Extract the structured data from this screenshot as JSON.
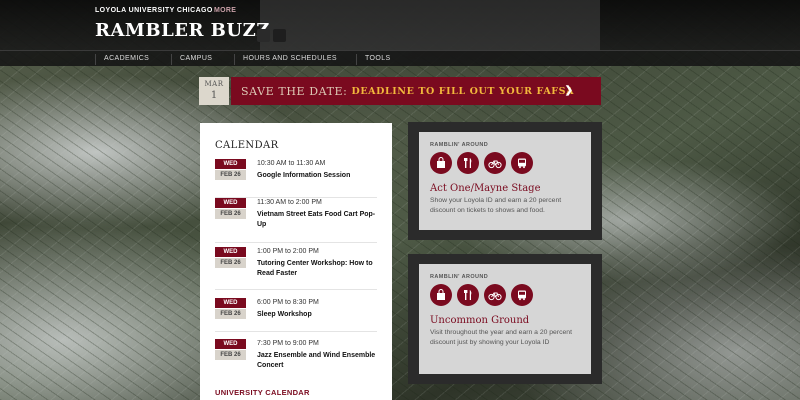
{
  "header": {
    "university": "LOYOLA UNIVERSITY CHICAGO",
    "more_label": "MORE",
    "site_title": "RAMBLER BUZZ"
  },
  "nav": {
    "items": [
      {
        "label": "ACADEMICS"
      },
      {
        "label": "CAMPUS"
      },
      {
        "label": "HOURS AND SCHEDULES"
      },
      {
        "label": "TOOLS"
      }
    ]
  },
  "banner": {
    "month": "MAR",
    "day": "1",
    "lead": "SAVE THE DATE:",
    "deadline": "DEADLINE TO FILL OUT YOUR FAFSA",
    "arrow_icon": "chevron-right-icon"
  },
  "calendar": {
    "title": "CALENDAR",
    "events": [
      {
        "weekday": "WED",
        "date": "FEB 26",
        "time": "10:30 AM to 11:30 AM",
        "name": "Google Information Session"
      },
      {
        "weekday": "WED",
        "date": "FEB 26",
        "time": "11:30 AM to 2:00 PM",
        "name": "Vietnam Street Eats Food Cart Pop-Up"
      },
      {
        "weekday": "WED",
        "date": "FEB 26",
        "time": "1:00 PM to 2:00 PM",
        "name": "Tutoring Center Workshop: How to Read Faster"
      },
      {
        "weekday": "WED",
        "date": "FEB 26",
        "time": "6:00 PM to 8:30 PM",
        "name": "Sleep Workshop"
      },
      {
        "weekday": "WED",
        "date": "FEB 26",
        "time": "7:30 PM to 9:00 PM",
        "name": "Jazz Ensemble and Wind Ensemble Concert"
      }
    ],
    "link_label": "UNIVERSITY CALENDAR"
  },
  "cards": [
    {
      "label": "RAMBLIN' AROUND",
      "icons": [
        "shopping-bag-icon",
        "fork-knife-icon",
        "bicycle-icon",
        "bus-icon"
      ],
      "title": "Act One/Mayne Stage",
      "description": "Show your Loyola ID and earn a 20 percent discount on tickets to shows and food."
    },
    {
      "label": "RAMBLIN' AROUND",
      "icons": [
        "shopping-bag-icon",
        "fork-knife-icon",
        "bicycle-icon",
        "bus-icon"
      ],
      "title": "Uncommon Ground",
      "description": "Visit throughout the year and earn a 20 percent discount just by showing your Loyola ID"
    }
  ],
  "colors": {
    "maroon": "#7a0a1f",
    "gold": "#f2b83c",
    "dark_header": "#141414"
  }
}
